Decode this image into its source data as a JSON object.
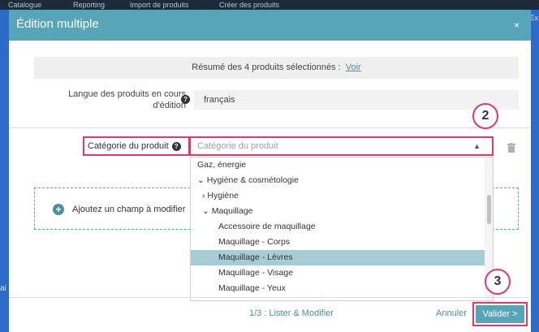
{
  "background": {
    "top_tabs": [
      "Catalogue",
      "Reporting",
      "Import de produits",
      "Créer des produits"
    ],
    "left_fragment": "ai",
    "right_fragment": "Ex"
  },
  "modal": {
    "title": "Édition multiple",
    "close_label": "×",
    "summary": {
      "text": "Résumé des 4 produits sélectionnés :",
      "link": "Voir"
    },
    "language": {
      "label": "Langue des produits en cours d'édition",
      "help": "?",
      "value": "français"
    },
    "category": {
      "label": "Catégorie du produit",
      "help": "?",
      "placeholder": "Catégorie du produit",
      "caret": "^"
    },
    "dropdown": {
      "items": [
        {
          "label": "Gaz, énergie"
        },
        {
          "label": "⌄ Hygiène & cosmétologie"
        },
        {
          "label": "› Hygiène"
        },
        {
          "label": "⌄ Maquillage"
        },
        {
          "label": "Accessoire de maquillage"
        },
        {
          "label": "Maquillage - Corps"
        },
        {
          "label": "Maquillage - Lèvres"
        },
        {
          "label": "Maquillage - Visage"
        },
        {
          "label": "Maquillage - Yeux"
        }
      ],
      "selected_index": 6
    },
    "add_field": {
      "label": "Ajoutez un champ à modifier"
    },
    "footer": {
      "step": "1/3 : Lister & Modifier",
      "cancel": "Annuler",
      "submit": "Valider >"
    }
  },
  "annotations": {
    "badge_2": "2",
    "badge_3": "3"
  },
  "colors": {
    "header": "#57a5b8",
    "accent": "#4a8fa3",
    "highlight": "#e0386a",
    "selected_row": "#a6cdd6"
  }
}
